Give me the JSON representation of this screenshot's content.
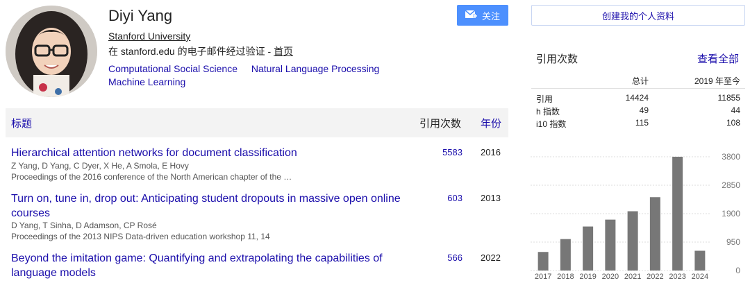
{
  "profile": {
    "name": "Diyi Yang",
    "affiliation": "Stanford University",
    "verified_text": "在 stanford.edu 的电子邮件经过验证 - ",
    "homepage_label": "首页",
    "interests": [
      "Computational Social Science",
      "Natural Language Processing",
      "Machine Learning"
    ],
    "follow_label": "关注"
  },
  "table": {
    "header_title": "标题",
    "header_cites": "引用次数",
    "header_year": "年份",
    "rows": [
      {
        "title": "Hierarchical attention networks for document classification",
        "authors": "Z Yang, D Yang, C Dyer, X He, A Smola, E Hovy",
        "venue": "Proceedings of the 2016 conference of the North American chapter of the …",
        "cites": "5583",
        "year": "2016"
      },
      {
        "title": "Turn on, tune in, drop out: Anticipating student dropouts in massive open online courses",
        "authors": "D Yang, T Sinha, D Adamson, CP Rosé",
        "venue": "Proceedings of the 2013 NIPS Data-driven education workshop 11, 14",
        "cites": "603",
        "year": "2013"
      },
      {
        "title": "Beyond the imitation game: Quantifying and extrapolating the capabilities of language models",
        "authors": "",
        "venue": "",
        "cites": "566",
        "year": "2022"
      }
    ]
  },
  "sidebar": {
    "create_profile_label": "创建我的个人资料",
    "cited_by_title": "引用次数",
    "view_all_label": "查看全部",
    "col_total": "总计",
    "col_since": "2019 年至今",
    "stats": [
      {
        "label": "引用",
        "total": "14424",
        "since": "11855"
      },
      {
        "label": "h 指数",
        "total": "49",
        "since": "44"
      },
      {
        "label": "i10 指数",
        "total": "115",
        "since": "108"
      }
    ]
  },
  "chart_data": {
    "type": "bar",
    "categories": [
      "2017",
      "2018",
      "2019",
      "2020",
      "2021",
      "2022",
      "2023",
      "2024"
    ],
    "values": [
      620,
      1050,
      1470,
      1700,
      1980,
      2450,
      3800,
      660
    ],
    "ylim": [
      0,
      3800
    ],
    "yticks": [
      "3800",
      "2850",
      "1900",
      "950",
      "0"
    ],
    "bar_color": "#777777",
    "grid": true
  }
}
